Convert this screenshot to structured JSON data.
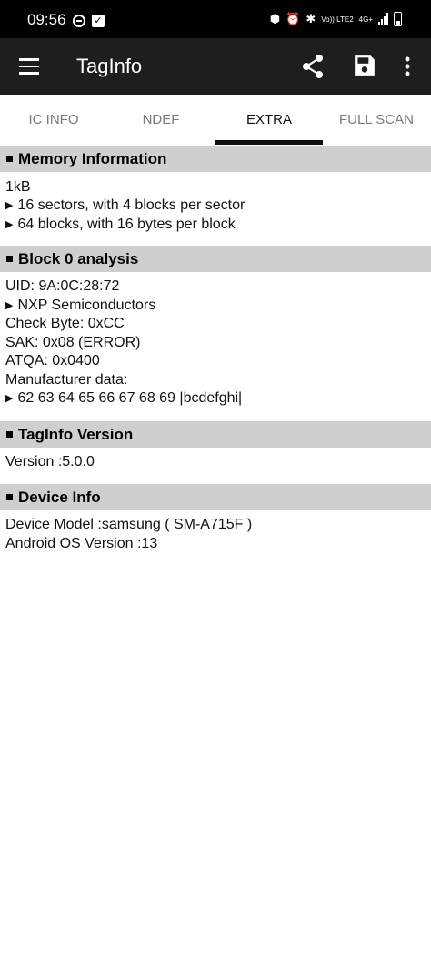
{
  "status_bar": {
    "time": "09:56",
    "volte_label": "Vo)) LTE2",
    "network": "4G+"
  },
  "app_bar": {
    "title": "TagInfo",
    "icons": [
      "menu-icon",
      "share-icon",
      "save-icon",
      "more-vert-icon"
    ]
  },
  "tabs": [
    {
      "label": "IC INFO",
      "active": false
    },
    {
      "label": "NDEF",
      "active": false
    },
    {
      "label": "EXTRA",
      "active": true
    },
    {
      "label": "FULL SCAN",
      "active": false
    }
  ],
  "sections": {
    "memory": {
      "title": "Memory Information",
      "lines": [
        "1kB",
        "16 sectors, with 4 blocks per sector",
        "64 blocks, with 16 bytes per block"
      ]
    },
    "block0": {
      "title": "Block 0 analysis",
      "lines": [
        "UID: 9A:0C:28:72",
        "NXP Semiconductors",
        "Check Byte: 0xCC",
        "SAK: 0x08 (ERROR)",
        "ATQA: 0x0400",
        "Manufacturer data:",
        "62 63 64 65 66 67 68 69 |bcdefghi|"
      ]
    },
    "version": {
      "title": "TagInfo Version",
      "lines": [
        "Version :5.0.0"
      ]
    },
    "device": {
      "title": "Device Info",
      "lines": [
        "Device Model :samsung ( SM-A715F )",
        "Android OS Version :13"
      ]
    }
  },
  "colors": {
    "app_bar": "#1e1e1e",
    "section_header": "#cfcfcf",
    "tab_indicator": "#111111"
  }
}
